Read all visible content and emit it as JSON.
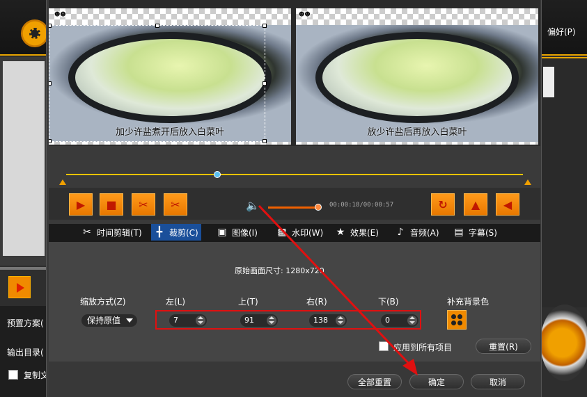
{
  "app": {
    "preference_label": "偏好(P)",
    "preset_label": "预置方案(",
    "output_label": "输出目录(",
    "copy_label": "复制文"
  },
  "preview": {
    "subtitle_left": "加少许盐煮开后放入白菜叶",
    "subtitle_right": "放少许盐后再放入白菜叶",
    "time_display": "00:00:18/00:00:57"
  },
  "tabs": [
    {
      "label": "时间剪辑(T)",
      "icon": "scissors-icon"
    },
    {
      "label": "裁剪(C)",
      "icon": "crop-icon"
    },
    {
      "label": "图像(I)",
      "icon": "image-icon"
    },
    {
      "label": "水印(W)",
      "icon": "watermark-icon"
    },
    {
      "label": "效果(E)",
      "icon": "star-icon"
    },
    {
      "label": "音频(A)",
      "icon": "music-note-icon"
    },
    {
      "label": "字幕(S)",
      "icon": "subtitle-icon"
    }
  ],
  "crop": {
    "original_size": "原始画面尺寸: 1280x720",
    "zoom_mode_label": "缩放方式(Z)",
    "zoom_mode_value": "保持原值",
    "left_label": "左(L)",
    "left_value": "7",
    "top_label": "上(T)",
    "top_value": "91",
    "right_label": "右(R)",
    "right_value": "138",
    "bottom_label": "下(B)",
    "bottom_value": "0",
    "bg_color_label": "补充背景色",
    "apply_all_label": "应用到所有项目",
    "reset_label": "重置(R)"
  },
  "footer": {
    "reset_all_label": "全部重置",
    "ok_label": "确定",
    "cancel_label": "取消"
  },
  "colors": {
    "accent": "#f08a00",
    "active_tab": "#1a4f9a",
    "highlight": "#e01010"
  }
}
